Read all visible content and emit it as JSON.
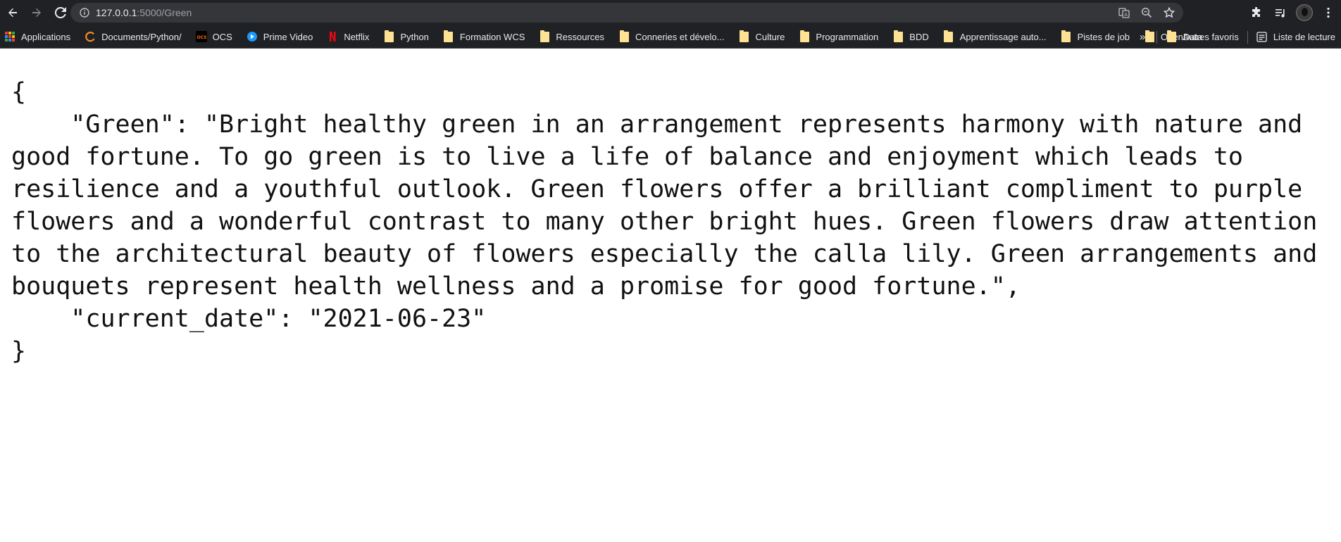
{
  "browser": {
    "url_host": "127.0.0.1",
    "url_path": ":5000/Green"
  },
  "bookmarks": [
    {
      "label": "Applications",
      "icon": "apps-grid-icon"
    },
    {
      "label": "Documents/Python/",
      "icon": "site-icon"
    },
    {
      "label": "OCS",
      "icon": "ocs-icon"
    },
    {
      "label": "Prime Video",
      "icon": "prime-video-icon"
    },
    {
      "label": "Netflix",
      "icon": "netflix-icon"
    },
    {
      "label": "Python",
      "icon": "folder-icon"
    },
    {
      "label": "Formation WCS",
      "icon": "folder-icon"
    },
    {
      "label": "Ressources",
      "icon": "folder-icon"
    },
    {
      "label": "Conneries et dévelo...",
      "icon": "folder-icon"
    },
    {
      "label": "Culture",
      "icon": "folder-icon"
    },
    {
      "label": "Programmation",
      "icon": "folder-icon"
    },
    {
      "label": "BDD",
      "icon": "folder-icon"
    },
    {
      "label": "Apprentissage auto...",
      "icon": "folder-icon"
    },
    {
      "label": "Pistes de job",
      "icon": "folder-icon"
    },
    {
      "label": "OpenData",
      "icon": "folder-icon"
    }
  ],
  "bookmarks_right": {
    "overflow": "»",
    "other_favorites": "Autres favoris",
    "reading_list": "Liste de lecture"
  },
  "page": {
    "json_text": "{\n    \"Green\": \"Bright healthy green in an arrangement represents harmony with nature and good fortune. To go green is to live a life of balance and enjoyment which leads to resilience and a youthful outlook. Green flowers offer a brilliant compliment to purple flowers and a wonderful contrast to many other bright hues. Green flowers draw attention to the architectural beauty of flowers especially the calla lily. Green arrangements and bouquets represent health wellness and a promise for good fortune.\",\n    \"current_date\": \"2021-06-23\"\n}"
  }
}
